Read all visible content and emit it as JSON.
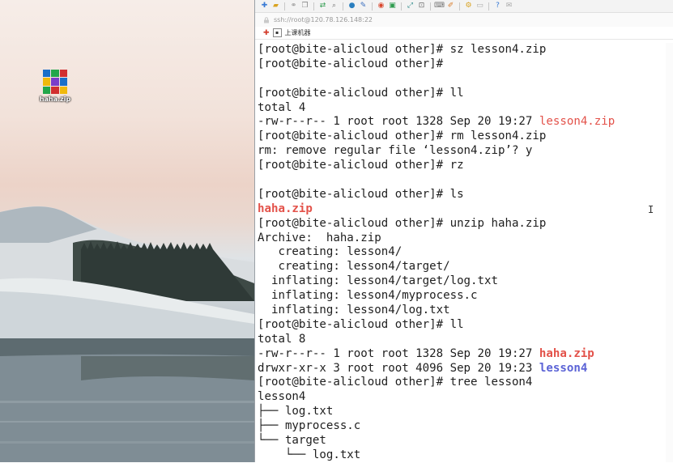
{
  "desktop": {
    "icon_label": "haha.zip"
  },
  "window": {
    "address": "ssh://root@120.78.126.148:22",
    "tab_label": "上课机器"
  },
  "terminal": {
    "lines": [
      {
        "text": "[root@bite-alicloud other]# sz lesson4.zip",
        "suffix": "",
        "suffix_style": ""
      },
      {
        "text": "[root@bite-alicloud other]# ",
        "suffix": "",
        "suffix_style": ""
      },
      {
        "text": "",
        "suffix": "",
        "suffix_style": ""
      },
      {
        "text": "[root@bite-alicloud other]# ll",
        "suffix": "",
        "suffix_style": ""
      },
      {
        "text": "total 4",
        "suffix": "",
        "suffix_style": ""
      },
      {
        "text": "-rw-r--r-- 1 root root 1328 Sep 20 19:27 ",
        "suffix": "lesson4.zip",
        "suffix_style": "red"
      },
      {
        "text": "[root@bite-alicloud other]# rm lesson4.zip",
        "suffix": "",
        "suffix_style": ""
      },
      {
        "text": "rm: remove regular file ‘lesson4.zip’? y",
        "suffix": "",
        "suffix_style": ""
      },
      {
        "text": "[root@bite-alicloud other]# rz",
        "suffix": "",
        "suffix_style": ""
      },
      {
        "text": "",
        "suffix": "",
        "suffix_style": ""
      },
      {
        "text": "[root@bite-alicloud other]# ls",
        "suffix": "",
        "suffix_style": ""
      },
      {
        "text": "",
        "suffix": "haha.zip",
        "suffix_style": "red-bold"
      },
      {
        "text": "[root@bite-alicloud other]# unzip haha.zip",
        "suffix": "",
        "suffix_style": ""
      },
      {
        "text": "Archive:  haha.zip",
        "suffix": "",
        "suffix_style": ""
      },
      {
        "text": "   creating: lesson4/",
        "suffix": "",
        "suffix_style": ""
      },
      {
        "text": "   creating: lesson4/target/",
        "suffix": "",
        "suffix_style": ""
      },
      {
        "text": "  inflating: lesson4/target/log.txt",
        "suffix": "",
        "suffix_style": ""
      },
      {
        "text": "  inflating: lesson4/myprocess.c",
        "suffix": "",
        "suffix_style": ""
      },
      {
        "text": "  inflating: lesson4/log.txt",
        "suffix": "",
        "suffix_style": ""
      },
      {
        "text": "[root@bite-alicloud other]# ll",
        "suffix": "",
        "suffix_style": ""
      },
      {
        "text": "total 8",
        "suffix": "",
        "suffix_style": ""
      },
      {
        "text": "-rw-r--r-- 1 root root 1328 Sep 20 19:27 ",
        "suffix": "haha.zip",
        "suffix_style": "red-bold"
      },
      {
        "text": "drwxr-xr-x 3 root root 4096 Sep 20 19:23 ",
        "suffix": "lesson4",
        "suffix_style": "blue"
      },
      {
        "text": "[root@bite-alicloud other]# tree lesson4",
        "suffix": "",
        "suffix_style": ""
      },
      {
        "text": "lesson4",
        "suffix": "",
        "suffix_style": ""
      },
      {
        "text": "├── log.txt",
        "suffix": "",
        "suffix_style": ""
      },
      {
        "text": "├── myprocess.c",
        "suffix": "",
        "suffix_style": ""
      },
      {
        "text": "└── target",
        "suffix": "",
        "suffix_style": ""
      },
      {
        "text": "    └── log.txt",
        "suffix": "",
        "suffix_style": ""
      }
    ]
  },
  "icons": [
    "new-session-icon",
    "folder-icon",
    "link-icon",
    "copy-icon",
    "search-icon",
    "globe-icon",
    "script-icon",
    "record-icon",
    "fullscreen-icon",
    "keyboard-icon",
    "settings-icon",
    "help-icon",
    "chat-icon"
  ],
  "colors": {
    "file_red": "#e3524a",
    "dir_blue": "#5b63d6",
    "terminal_bg": "#ffffff"
  }
}
